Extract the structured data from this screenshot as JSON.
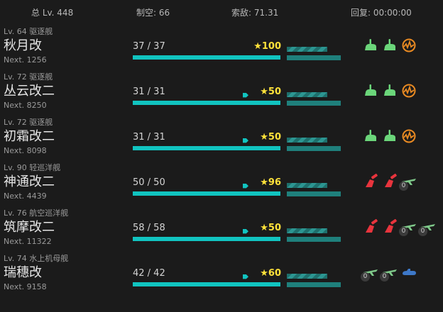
{
  "summary": {
    "total_level": "总 Lv. 448",
    "air_control": "制空: 66",
    "los": "索敌: 71.31",
    "repair": "回复: 00:00:00"
  },
  "ships": [
    {
      "level_type": "Lv. 64  驱逐舰",
      "name": "秋月改",
      "next": "Next. 1256",
      "hp": "37 / 37",
      "hp_fraction": 1.0,
      "morale": "★100",
      "tag": false,
      "equips": [
        {
          "icon": "gun-icon",
          "color": "#6bd67a"
        },
        {
          "icon": "gun-icon",
          "color": "#6bd67a"
        },
        {
          "icon": "aa-fire-director-icon",
          "color": "#e98a22"
        }
      ]
    },
    {
      "level_type": "Lv. 72  驱逐舰",
      "name": "丛云改二",
      "next": "Next. 8250",
      "hp": "31 / 31",
      "hp_fraction": 1.0,
      "morale": "★50",
      "tag": true,
      "equips": [
        {
          "icon": "gun-icon",
          "color": "#6bd67a"
        },
        {
          "icon": "gun-icon",
          "color": "#6bd67a"
        },
        {
          "icon": "aa-fire-director-icon",
          "color": "#e98a22"
        }
      ]
    },
    {
      "level_type": "Lv. 72  驱逐舰",
      "name": "初霜改二",
      "next": "Next. 8098",
      "hp": "31 / 31",
      "hp_fraction": 1.0,
      "morale": "★50",
      "tag": true,
      "equips": [
        {
          "icon": "gun-icon",
          "color": "#6bd67a"
        },
        {
          "icon": "gun-icon",
          "color": "#6bd67a"
        },
        {
          "icon": "aa-fire-director-icon",
          "color": "#e98a22"
        }
      ]
    },
    {
      "level_type": "Lv. 90  轻巡洋舰",
      "name": "神通改二",
      "next": "Next. 4439",
      "hp": "50 / 50",
      "hp_fraction": 1.0,
      "morale": "★96",
      "tag": true,
      "equips": [
        {
          "icon": "main-gun-icon",
          "color": "#e8343d"
        },
        {
          "icon": "main-gun-icon",
          "color": "#e8343d"
        },
        {
          "icon": "seaplane-icon",
          "color": "#7fc98a",
          "badge": "0"
        }
      ]
    },
    {
      "level_type": "Lv. 76  航空巡洋舰",
      "name": "筑摩改二",
      "next": "Next. 11322",
      "hp": "58 / 58",
      "hp_fraction": 1.0,
      "morale": "★50",
      "tag": true,
      "equips": [
        {
          "icon": "main-gun-icon",
          "color": "#e8343d"
        },
        {
          "icon": "main-gun-icon",
          "color": "#e8343d"
        },
        {
          "icon": "seaplane-icon",
          "color": "#7fc98a",
          "badge": "0"
        },
        {
          "icon": "seaplane-icon",
          "color": "#7fc98a",
          "badge": "0"
        }
      ]
    },
    {
      "level_type": "Lv. 74  水上机母舰",
      "name": "瑞穗改",
      "next": "Next. 9158",
      "hp": "42 / 42",
      "hp_fraction": 1.0,
      "morale": "★60",
      "tag": true,
      "equips": [
        {
          "icon": "seaplane-icon",
          "color": "#7fc98a",
          "badge": "0"
        },
        {
          "icon": "seaplane-icon",
          "color": "#7fc98a",
          "badge": "0"
        },
        {
          "icon": "submarine-icon",
          "color": "#3d78c8"
        }
      ]
    }
  ],
  "colors": {
    "hp_bar": "#11c4c0",
    "morale": "#ffe23a",
    "condition": "#1f807c"
  }
}
